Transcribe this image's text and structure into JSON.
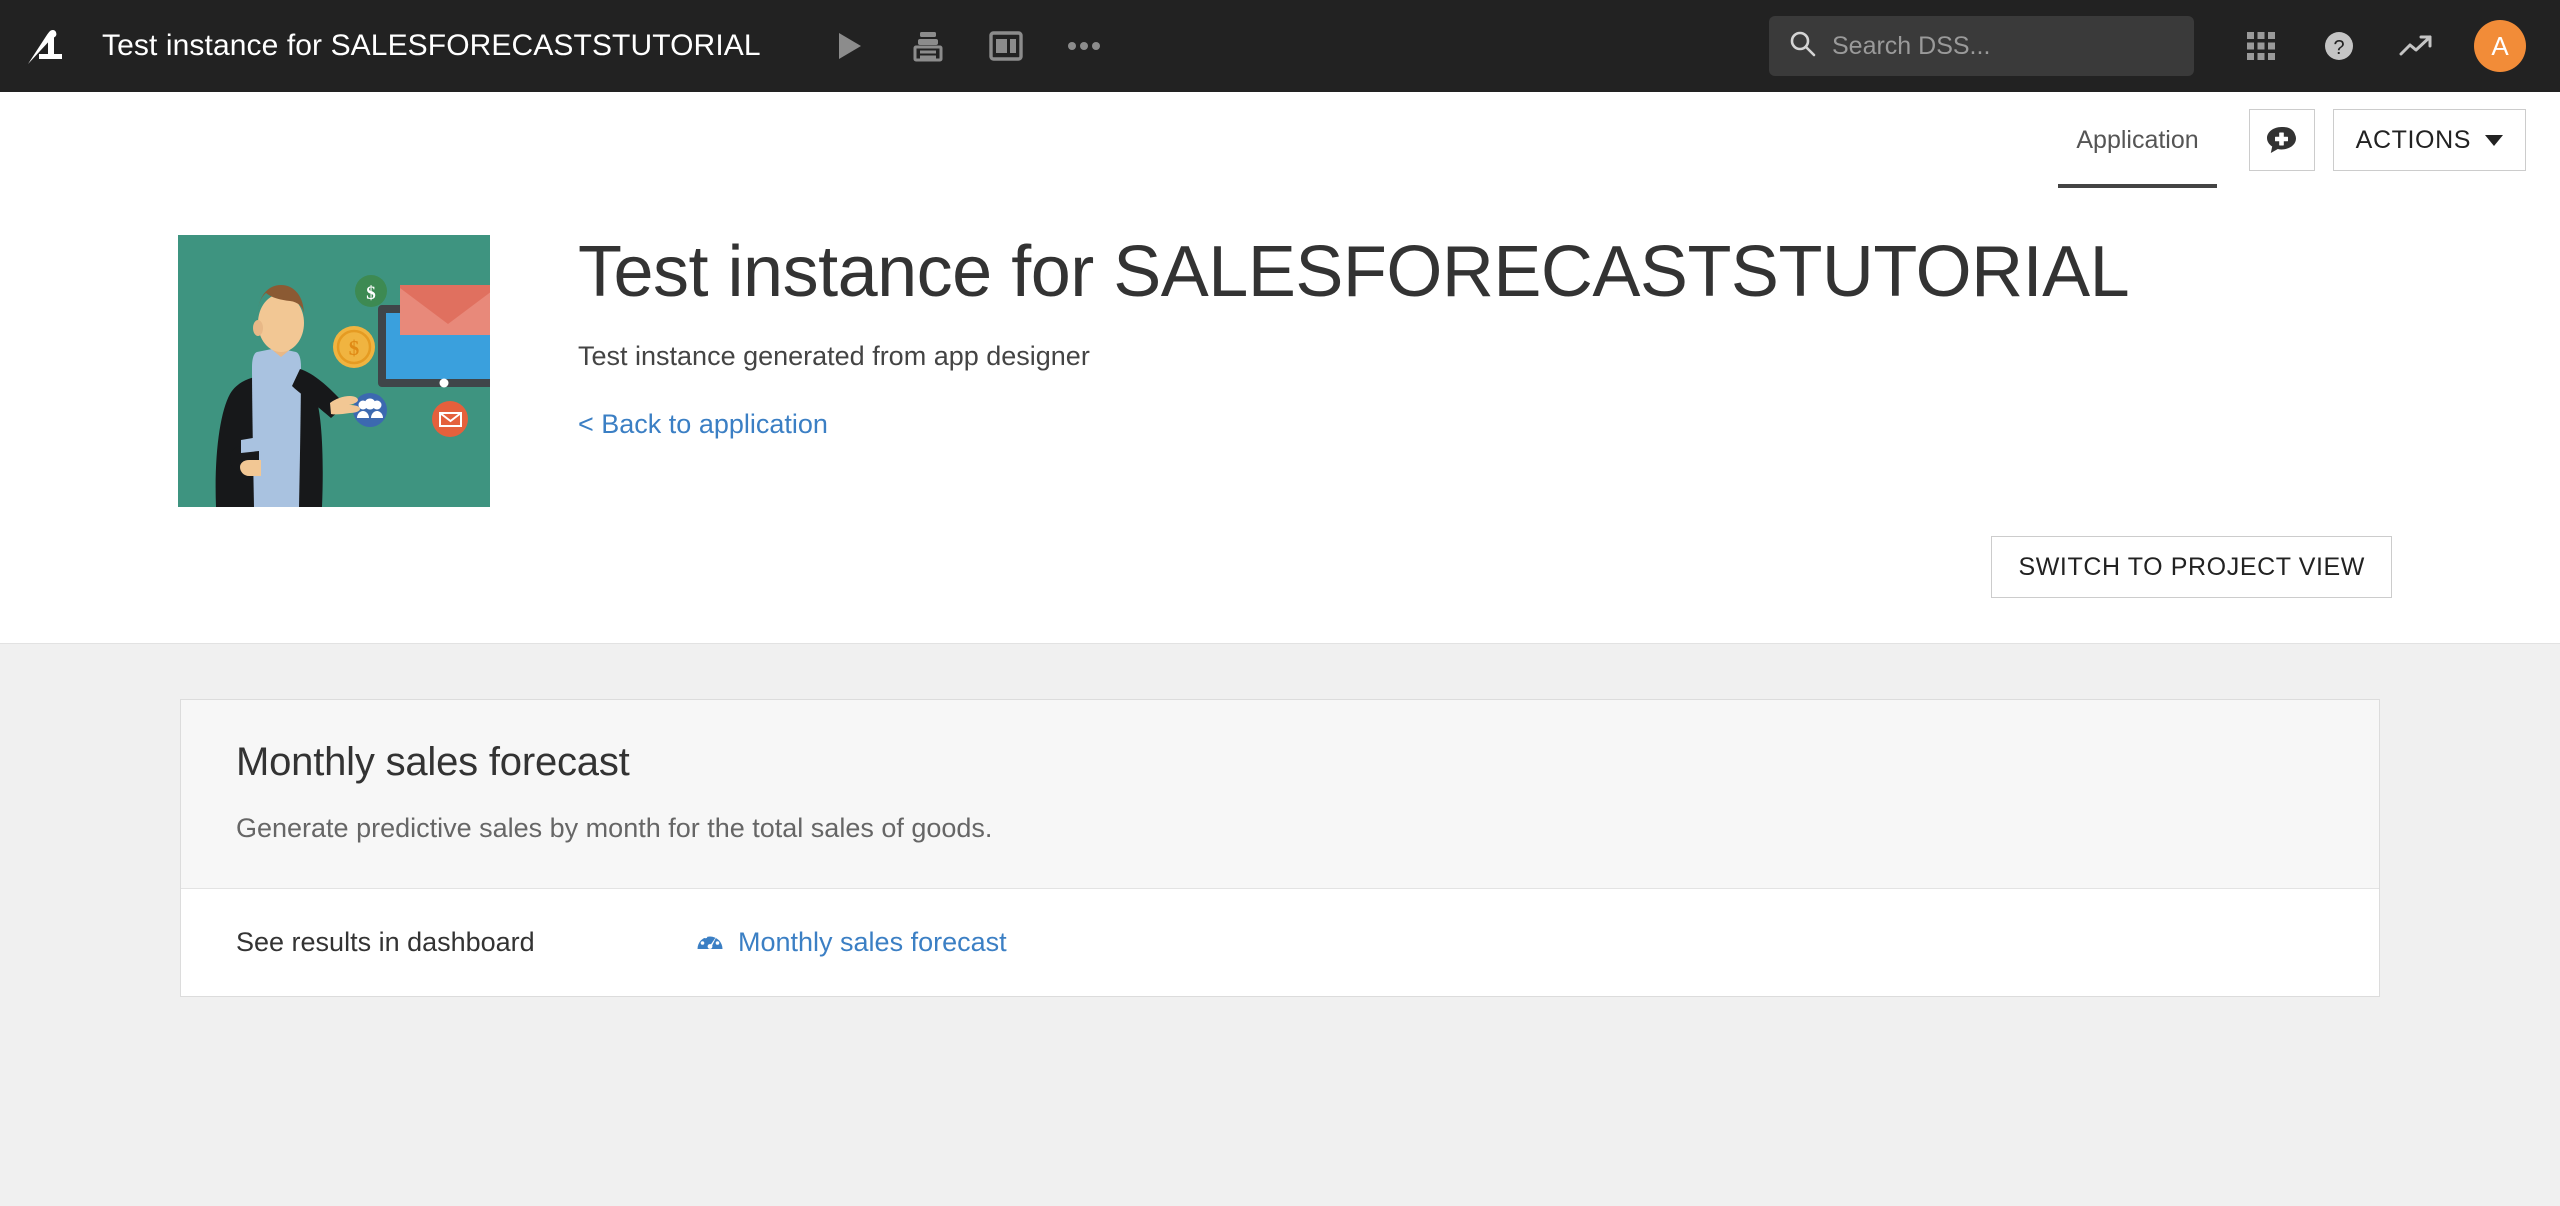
{
  "topbar": {
    "logo_name": "dataiku-bird-logo",
    "title": "Test instance for SALESFORECASTSTUTORIAL",
    "actions": [
      {
        "name": "run-icon",
        "label": "Run"
      },
      {
        "name": "printer-icon",
        "label": "Print"
      },
      {
        "name": "dashboard-layout-icon",
        "label": "Dashboards"
      },
      {
        "name": "ellipsis-icon",
        "label": "More"
      }
    ],
    "search": {
      "placeholder": "Search DSS...",
      "value": "",
      "icon": "search-icon"
    },
    "right_icons": [
      {
        "name": "apps-grid-icon",
        "label": "Apps"
      },
      {
        "name": "help-icon",
        "label": "Help"
      },
      {
        "name": "trending-up-icon",
        "label": "Activity"
      }
    ],
    "avatar_initial": "A",
    "avatar_color": "#f28c38",
    "background_color": "#222222"
  },
  "tabbar": {
    "tabs": [
      {
        "label": "Application",
        "active": true
      }
    ],
    "discussion_icon": "add-discussion-icon",
    "actions_label": "ACTIONS"
  },
  "hero": {
    "illustration_name": "businessman-sales-illustration",
    "illustration_bg": "#3e9480",
    "title": "Test instance for SALESFORECASTSTUTORIAL",
    "subtitle": "Test instance generated from app designer",
    "back_link": "< Back to application",
    "switch_button": "SWITCH TO PROJECT VIEW",
    "link_color": "#3b7fc4"
  },
  "card": {
    "title": "Monthly sales forecast",
    "description": "Generate predictive sales by month for the total sales of goods.",
    "row": {
      "label": "See results in dashboard",
      "link_icon": "dashboard-gauge-icon",
      "link_label": "Monthly sales forecast",
      "link_color": "#3b7fc4"
    }
  }
}
